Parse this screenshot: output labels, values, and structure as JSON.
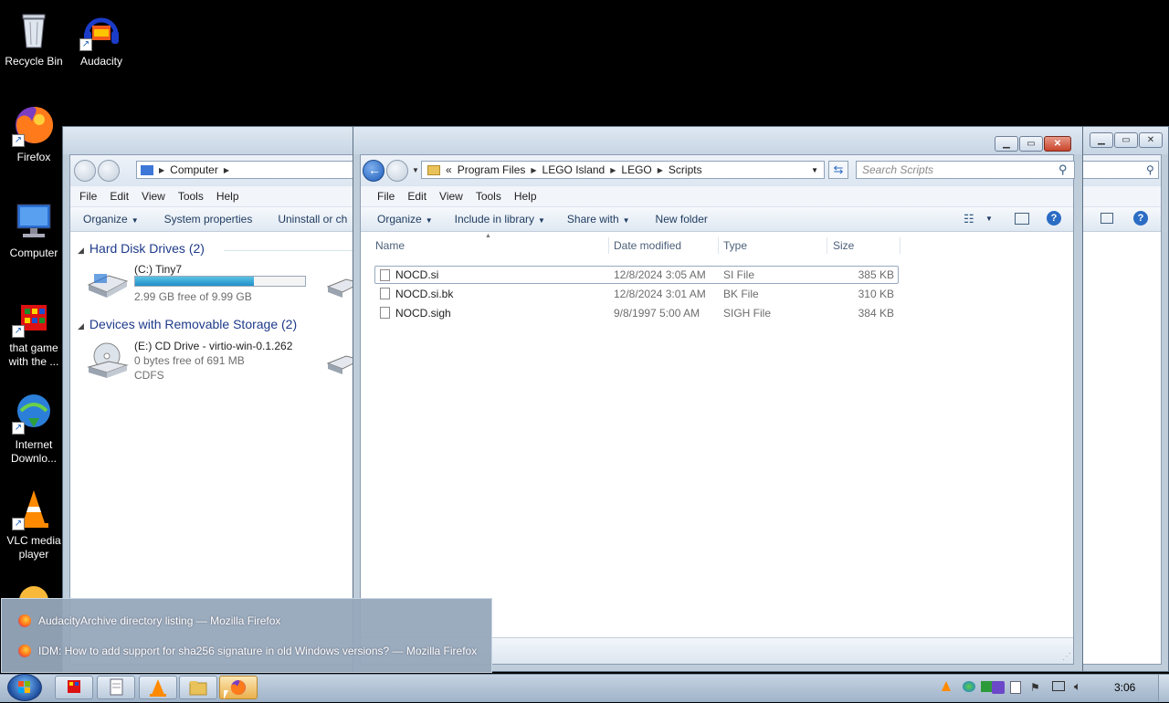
{
  "desktop": {
    "icons": [
      {
        "label": "Recycle Bin"
      },
      {
        "label": "Audacity"
      },
      {
        "label": "Firefox"
      },
      {
        "label": "Computer"
      },
      {
        "label_line1": "that game",
        "label_line2": "with the ..."
      },
      {
        "label_line1": "Internet",
        "label_line2": "Downlo..."
      },
      {
        "label_line1": "VLC media",
        "label_line2": "player"
      }
    ]
  },
  "computer_window": {
    "address": {
      "crumbs": [
        "Computer"
      ]
    },
    "menu": [
      "File",
      "Edit",
      "View",
      "Tools",
      "Help"
    ],
    "commands": [
      "Organize",
      "System properties",
      "Uninstall or ch"
    ],
    "sections": {
      "hard_disk": {
        "title": "Hard Disk Drives (2)"
      },
      "removable": {
        "title": "Devices with Removable Storage (2)"
      }
    },
    "drives": {
      "c": {
        "name": "(C:) Tiny7",
        "free": "2.99 GB free of 9.99 GB",
        "used_fraction": 0.7
      },
      "e": {
        "name": "(E:) CD Drive - virtio-win-0.1.262",
        "free": "0 bytes free of 691 MB",
        "fs": "CDFS"
      }
    }
  },
  "scripts_window": {
    "address": {
      "overflow": "«",
      "crumbs": [
        "Program Files",
        "LEGO Island",
        "LEGO",
        "Scripts"
      ]
    },
    "search_placeholder": "Search Scripts",
    "menu": [
      "File",
      "Edit",
      "View",
      "Tools",
      "Help"
    ],
    "commands": [
      "Organize",
      "Include in library",
      "Share with",
      "New folder"
    ],
    "columns": [
      "Name",
      "Date modified",
      "Type",
      "Size"
    ],
    "files": [
      {
        "name": "NOCD.si",
        "date": "12/8/2024 3:05 AM",
        "type": "SI File",
        "size": "385 KB"
      },
      {
        "name": "NOCD.si.bk",
        "date": "12/8/2024 3:01 AM",
        "type": "BK File",
        "size": "310 KB"
      },
      {
        "name": "NOCD.sigh",
        "date": "9/8/1997 5:00 AM",
        "type": "SIGH File",
        "size": "384 KB"
      }
    ]
  },
  "popup": {
    "items": [
      {
        "title": "AudacityArchive directory listing — Mozilla Firefox"
      },
      {
        "title": "IDM: How to add support for sha256 signature in old Windows versions? — Mozilla Firefox"
      }
    ]
  },
  "taskbar": {
    "clock": "3:06"
  }
}
